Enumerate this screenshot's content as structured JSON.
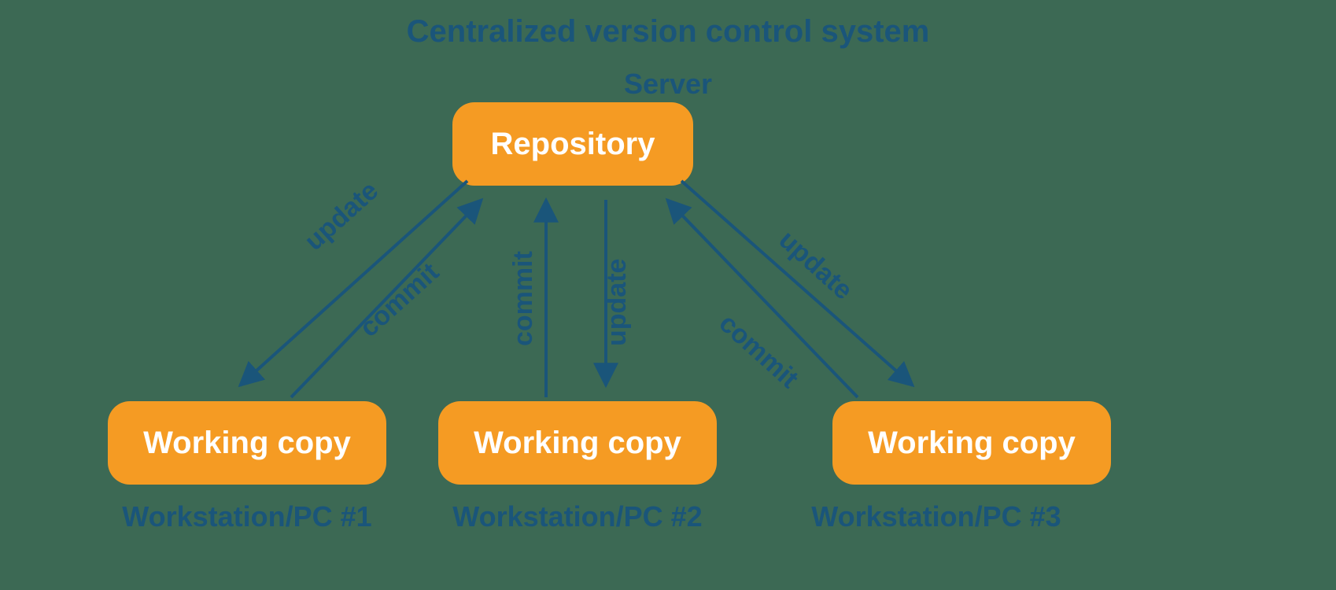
{
  "title": "Centralized version control system",
  "server": {
    "label": "Server",
    "node": "Repository"
  },
  "workstations": [
    {
      "node": "Working copy",
      "label": "Workstation/PC #1"
    },
    {
      "node": "Working copy",
      "label": "Workstation/PC #2"
    },
    {
      "node": "Working copy",
      "label": "Workstation/PC #3"
    }
  ],
  "edges": {
    "update": "update",
    "commit": "commit"
  },
  "colors": {
    "background": "#3c6954",
    "node_fill": "#f59b23",
    "node_text": "#ffffff",
    "text": "#1a557a",
    "arrow": "#1a557a"
  }
}
